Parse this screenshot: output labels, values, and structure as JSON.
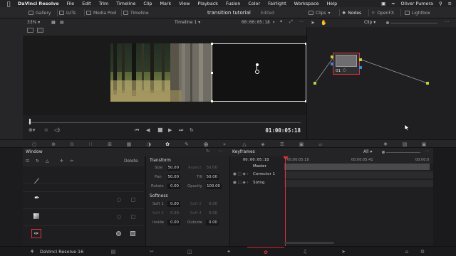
{
  "menubar": {
    "app_name": "DaVinci Resolve",
    "items": [
      "File",
      "Edit",
      "Trim",
      "Timeline",
      "Clip",
      "Mark",
      "View",
      "Playback",
      "Fusion",
      "Color",
      "Fairlight",
      "Workspace",
      "Help"
    ],
    "user": "Oliver Pumera"
  },
  "toolbar": {
    "gallery": "Gallery",
    "luts": "LUTs",
    "media_pool": "Media Pool",
    "timeline": "Timeline",
    "project_title": "transition tutorial",
    "project_status": "Edited",
    "clips": "Clips",
    "nodes": "Nodes",
    "openfx": "OpenFX",
    "lightbox": "Lightbox"
  },
  "viewer": {
    "zoom": "33%",
    "timeline_name": "Timeline 1",
    "timecode_top": "00:00:05:18",
    "timecode": "01:00:05:18"
  },
  "nodes_panel": {
    "mode": "Clip",
    "node_label": "01"
  },
  "window_panel": {
    "title": "Window",
    "delete_label": "Delete",
    "transform_title": "Transform",
    "size_label": "Size",
    "size_value": "50.00",
    "aspect_label": "Aspect",
    "aspect_value": "50.00",
    "pan_label": "Pan",
    "pan_value": "50.00",
    "tilt_label": "Tilt",
    "tilt_value": "50.00",
    "rotate_label": "Rotate",
    "rotate_value": "0.00",
    "opacity_label": "Opacity",
    "opacity_value": "100.00",
    "softness_title": "Softness",
    "soft1_label": "Soft 1",
    "soft1_value": "0.00",
    "soft2_label": "Soft 2",
    "soft2_value": "0.00",
    "soft3_label": "Soft 3",
    "soft3_value": "0.00",
    "soft4_label": "Soft 4",
    "soft4_value": "0.00",
    "inside_label": "Inside",
    "inside_value": "0.00",
    "outside_label": "Outside",
    "outside_value": "0.00"
  },
  "keyframes": {
    "title": "Keyframes",
    "filter": "All",
    "timecode": "00:00:05:18",
    "ruler": [
      "00:00:05:18",
      "00:00:05:41",
      "00:00:0"
    ],
    "tracks": [
      "Master",
      "Corrector 1",
      "Sizing"
    ]
  },
  "bottombar": {
    "app_label": "DaVinci Resolve 16"
  },
  "colors": {
    "accent_red": "#e0313b",
    "node_green": "#b8d23a",
    "node_blue": "#2f8fe0"
  }
}
